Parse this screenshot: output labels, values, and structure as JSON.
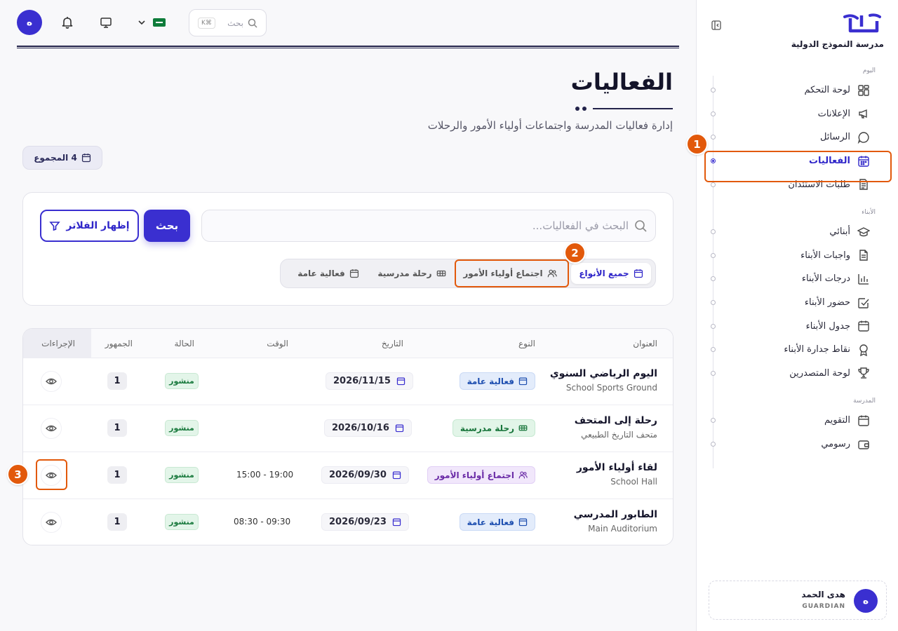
{
  "topbar": {
    "avatar_initial": "ه",
    "search_placeholder": "بحث",
    "search_shortcut": "K⌘"
  },
  "sidebar": {
    "school_name": "مدرسة النموذج الدولية",
    "sections": {
      "today": "اليوم",
      "children": "الأبناء",
      "school": "المدرسة"
    },
    "items_today": [
      {
        "label": "لوحة التحكم",
        "icon": "grid-icon"
      },
      {
        "label": "الإعلانات",
        "icon": "megaphone-icon"
      },
      {
        "label": "الرسائل",
        "icon": "chat-icon"
      },
      {
        "label": "الفعاليات",
        "icon": "calendar-icon",
        "active": true
      },
      {
        "label": "طلبات الاستئذان",
        "icon": "document-icon"
      }
    ],
    "items_children": [
      {
        "label": "أبنائي",
        "icon": "graduation-cap-icon"
      },
      {
        "label": "واجبات الأبناء",
        "icon": "file-icon"
      },
      {
        "label": "درجات الأبناء",
        "icon": "bar-chart-icon"
      },
      {
        "label": "حضور الأبناء",
        "icon": "check-square-icon"
      },
      {
        "label": "جدول الأبناء",
        "icon": "calendar-icon"
      },
      {
        "label": "نقاط جدارة الأبناء",
        "icon": "award-icon"
      },
      {
        "label": "لوحة المتصدرين",
        "icon": "trophy-icon"
      }
    ],
    "items_school": [
      {
        "label": "التقويم",
        "icon": "calendar-icon"
      },
      {
        "label": "رسومي",
        "icon": "wallet-icon"
      }
    ],
    "user": {
      "initial": "ه",
      "name": "هدى الحمد",
      "role": "GUARDIAN"
    }
  },
  "main": {
    "title": "الفعاليات",
    "subtitle": "إدارة فعاليات المدرسة واجتماعات أولياء الأمور والرحلات",
    "total_badge": "4 المجموع",
    "search_placeholder": "البحث في الفعاليات...",
    "search_button": "بحث",
    "filters_button": "إظهار الفلاتر",
    "type_tabs": [
      {
        "label": "جميع الأنواع",
        "icon": "calendar-icon",
        "active": true
      },
      {
        "label": "اجتماع أولياء الأمور",
        "icon": "users-icon"
      },
      {
        "label": "رحلة مدرسية",
        "icon": "bus-icon"
      },
      {
        "label": "فعالية عامة",
        "icon": "calendar-icon"
      }
    ]
  },
  "table": {
    "headers": {
      "title": "العنوان",
      "type": "النوع",
      "date": "التاريخ",
      "time": "الوقت",
      "status": "الحالة",
      "audience": "الجمهور",
      "actions": "الإجراءات"
    },
    "rows": [
      {
        "title": "اليوم الرياضي السنوي",
        "location": "School Sports Ground",
        "type": "فعالية عامة",
        "type_kind": "public",
        "date": "2026/11/15",
        "time": "",
        "status": "منشور",
        "audience": "1"
      },
      {
        "title": "رحلة إلى المتحف",
        "location": "متحف التاريخ الطبيعي",
        "type": "رحلة مدرسية",
        "type_kind": "trip",
        "date": "2026/10/16",
        "time": "",
        "status": "منشور",
        "audience": "1"
      },
      {
        "title": "لقاء أولياء الأمور",
        "location": "School Hall",
        "type": "اجتماع أولياء الأمور",
        "type_kind": "parent",
        "date": "2026/09/30",
        "time": "15:00 - 19:00",
        "status": "منشور",
        "audience": "1"
      },
      {
        "title": "الطابور المدرسي",
        "location": "Main Auditorium",
        "type": "فعالية عامة",
        "type_kind": "public",
        "date": "2026/09/23",
        "time": "08:30 - 09:30",
        "status": "منشور",
        "audience": "1"
      }
    ]
  },
  "annotations": [
    "1",
    "2",
    "3"
  ],
  "colors": {
    "accent": "#3a2fd0",
    "callout": "#e2590b",
    "published": "#1a7a3e"
  }
}
